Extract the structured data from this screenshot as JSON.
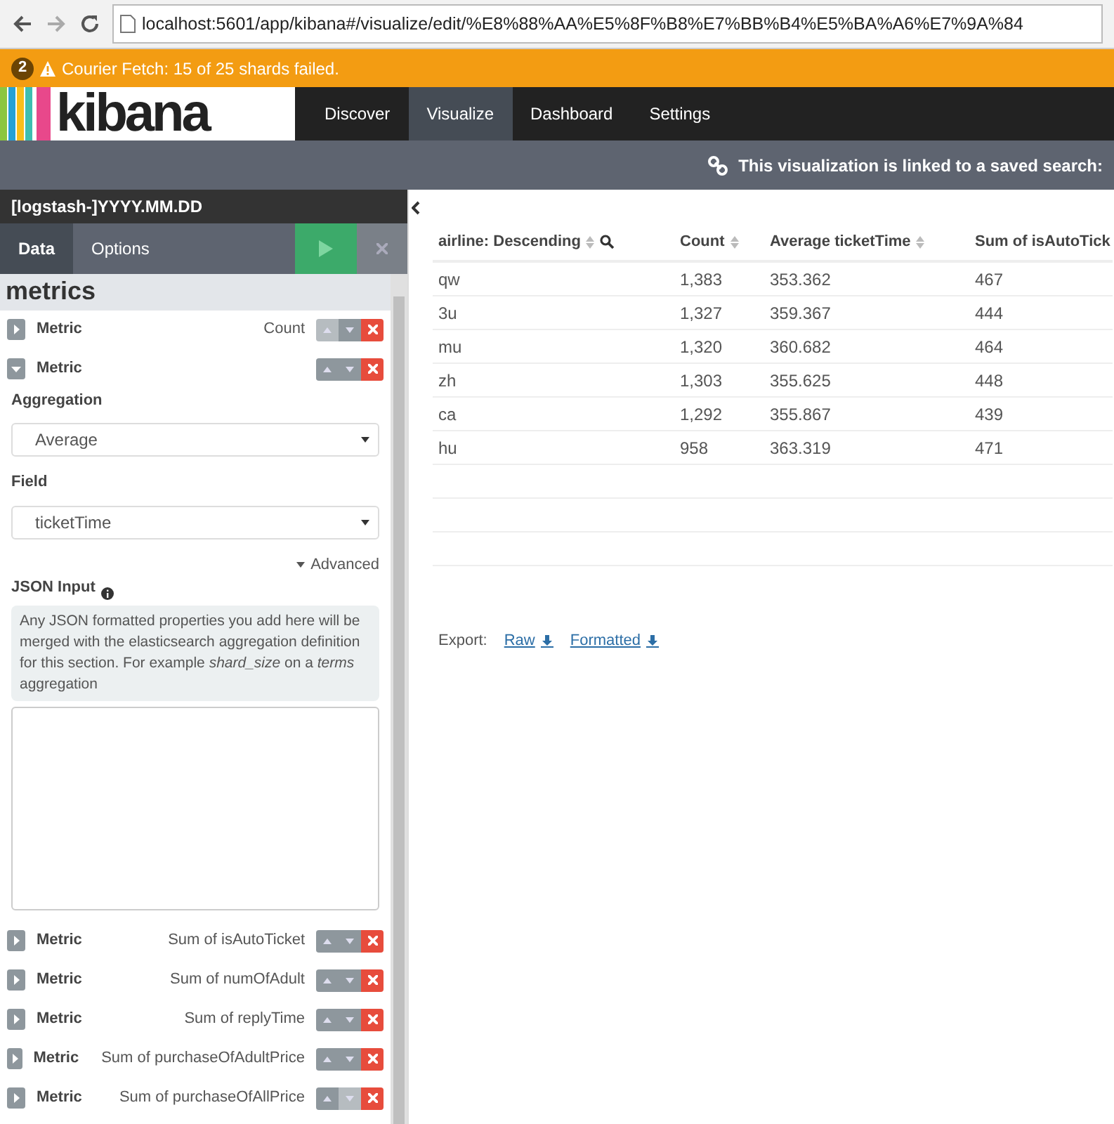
{
  "browser": {
    "url": "localhost:5601/app/kibana#/visualize/edit/%E8%88%AA%E5%8F%B8%E7%BB%B4%E5%BA%A6%E7%9A%84"
  },
  "alert": {
    "count": "2",
    "message": "Courier Fetch: 15 of 25 shards failed."
  },
  "nav": {
    "logo": "kibana",
    "items": [
      {
        "label": "Discover",
        "selected": false
      },
      {
        "label": "Visualize",
        "selected": true
      },
      {
        "label": "Dashboard",
        "selected": false
      },
      {
        "label": "Settings",
        "selected": false
      }
    ]
  },
  "linked_notice": "This visualization is linked to a saved search:",
  "sidebar": {
    "index_pattern": "[logstash-]YYYY.MM.DD",
    "tabs": [
      {
        "label": "Data",
        "selected": true
      },
      {
        "label": "Options",
        "selected": false
      }
    ],
    "section_title": "metrics",
    "metrics": [
      {
        "label": "Metric",
        "summary": "Count",
        "expanded": false,
        "up_disabled": true,
        "down_disabled": false
      },
      {
        "label": "Metric",
        "expanded": true,
        "up_disabled": false,
        "down_disabled": false,
        "editor": {
          "aggregation_label": "Aggregation",
          "aggregation_value": "Average",
          "field_label": "Field",
          "field_value": "ticketTime",
          "advanced_link": "Advanced",
          "json_label": "JSON Input",
          "help": "Any JSON formatted properties you add here will be merged with the elasticsearch aggregation definition for this section. For example *shard_size* on a *terms* aggregation"
        }
      },
      {
        "label": "Metric",
        "summary": "Sum of isAutoTicket",
        "expanded": false,
        "up_disabled": false,
        "down_disabled": false
      },
      {
        "label": "Metric",
        "summary": "Sum of numOfAdult",
        "expanded": false,
        "up_disabled": false,
        "down_disabled": false
      },
      {
        "label": "Metric",
        "summary": "Sum of replyTime",
        "expanded": false,
        "up_disabled": false,
        "down_disabled": false
      },
      {
        "label": "Metric",
        "summary": "Sum of purchaseOfAdultPrice",
        "expanded": false,
        "up_disabled": false,
        "down_disabled": false
      },
      {
        "label": "Metric",
        "summary": "Sum of purchaseOfAllPrice",
        "expanded": false,
        "up_disabled": false,
        "down_disabled": true
      }
    ]
  },
  "table": {
    "columns": [
      {
        "label": "airline: Descending",
        "search": true,
        "sort": true
      },
      {
        "label": "Count",
        "search": false,
        "sort": true
      },
      {
        "label": "Average ticketTime",
        "search": false,
        "sort": true
      },
      {
        "label": "Sum of isAutoTick"
      }
    ],
    "rows": [
      [
        "qw",
        "1,383",
        "353.362",
        "467"
      ],
      [
        "3u",
        "1,327",
        "359.367",
        "444"
      ],
      [
        "mu",
        "1,320",
        "360.682",
        "464"
      ],
      [
        "zh",
        "1,303",
        "355.625",
        "448"
      ],
      [
        "ca",
        "1,292",
        "355.867",
        "439"
      ],
      [
        "hu",
        "958",
        "363.319",
        "471"
      ]
    ]
  },
  "export": {
    "label": "Export:",
    "links": [
      "Raw",
      "Formatted"
    ]
  }
}
